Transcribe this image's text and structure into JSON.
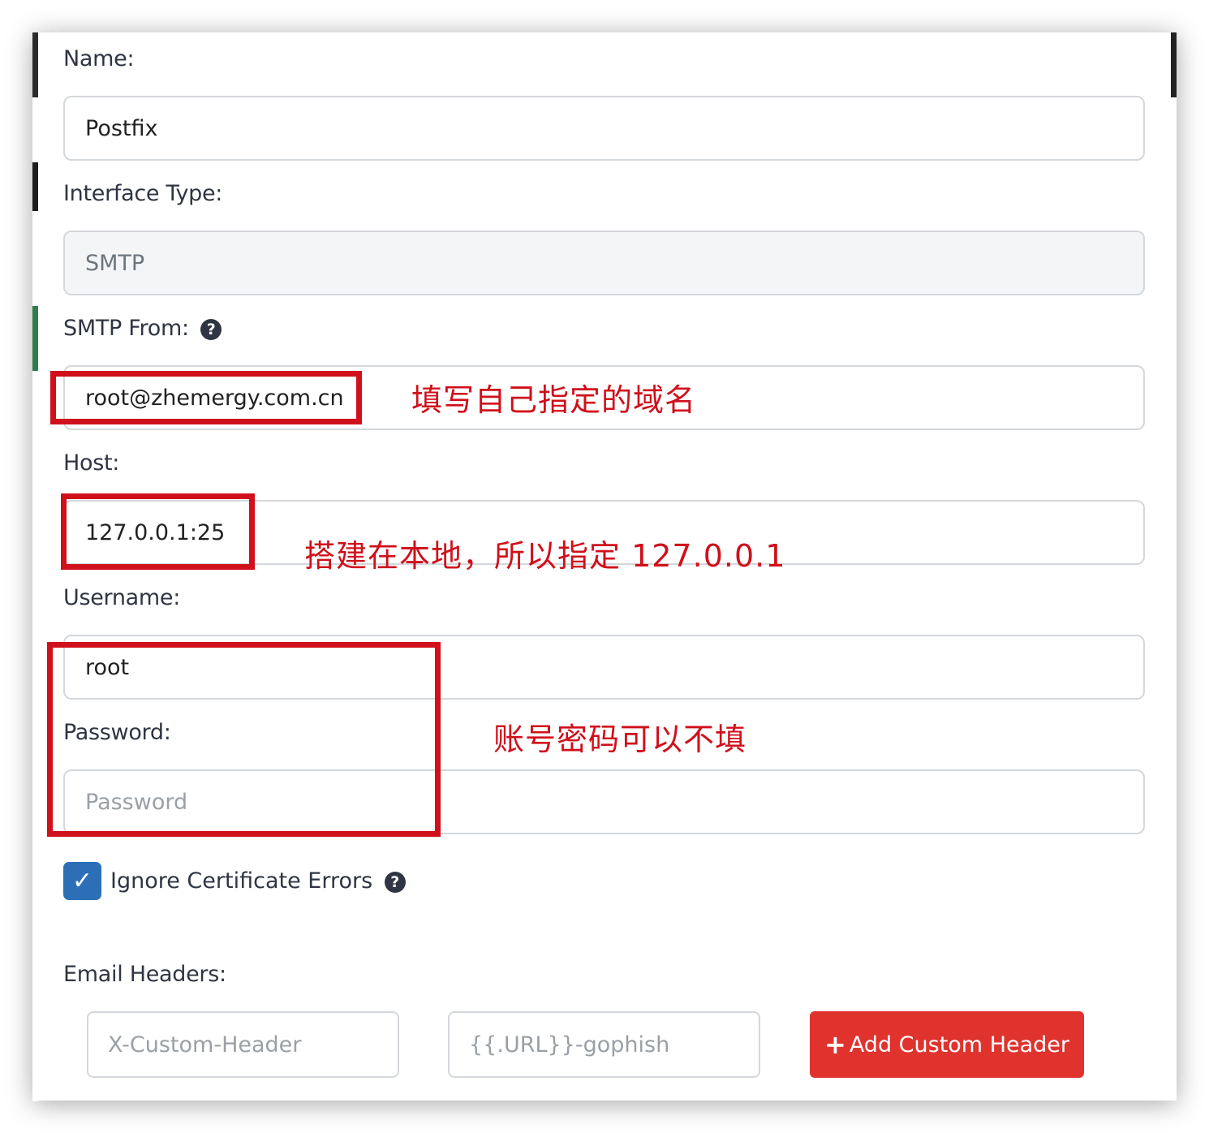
{
  "form": {
    "name_label": "Name:",
    "name_value": "Postfix",
    "interface_label": "Interface Type:",
    "interface_value": "SMTP",
    "smtp_from_label": "SMTP From:",
    "smtp_from_value": "root@zhemergy.com.cn",
    "host_label": "Host:",
    "host_value": "127.0.0.1:25",
    "username_label": "Username:",
    "username_value": "root",
    "password_label": "Password:",
    "password_placeholder": "Password",
    "ignore_cert_label": "Ignore Certificate Errors",
    "ignore_cert_checked": true,
    "email_headers_label": "Email Headers:",
    "header_name_placeholder": "X-Custom-Header",
    "header_value_placeholder": "{{.URL}}-gophish",
    "add_header_label": "Add Custom Header"
  },
  "annotations": {
    "domain_note": "填写自己指定的域名",
    "host_note": "搭建在本地，所以指定 127.0.0.1",
    "credentials_note": "账号密码可以不填"
  },
  "icons": {
    "help": "question-circle-icon",
    "check": "check-icon",
    "plus": "plus-icon"
  },
  "colors": {
    "annotation_red": "#d0101b",
    "checkbox_blue": "#2c6fb7",
    "button_red": "#e0332e"
  }
}
